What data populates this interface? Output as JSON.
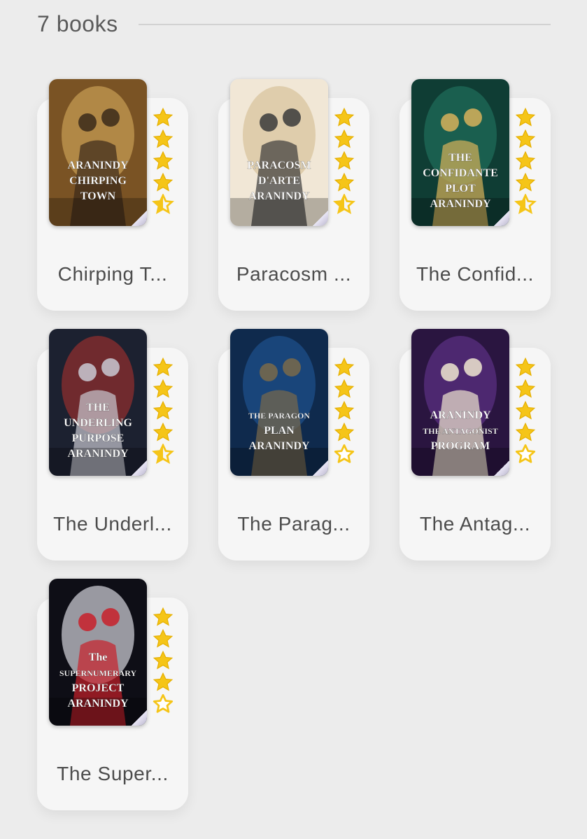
{
  "header": {
    "count_label": "7 books"
  },
  "colors": {
    "star": "#f5c518",
    "star_outline": "#e6b000",
    "card": "#f6f6f6",
    "background": "#ececec"
  },
  "books": [
    {
      "title": "Chirping Town",
      "display_title": "Chirping T...",
      "rating": 4.5,
      "cover_text": [
        "ARANINDY",
        "CHIRPING",
        "TOWN"
      ],
      "cover_colors": [
        "#7a5324",
        "#c49a52",
        "#3b2a1a"
      ]
    },
    {
      "title": "Paracosm D'Arte",
      "display_title": "Paracosm ...",
      "rating": 4.5,
      "cover_text": [
        "PARACOSM",
        "D'ARTE",
        "ARANINDY"
      ],
      "cover_colors": [
        "#f1e7d6",
        "#d8c49e",
        "#3a3a3a"
      ]
    },
    {
      "title": "The Confidante Plot",
      "display_title": "The Confid...",
      "rating": 4.5,
      "cover_text": [
        "THE",
        "CONFIDANTE",
        "PLOT",
        "ARANINDY"
      ],
      "cover_colors": [
        "#0f3d34",
        "#1f6b58",
        "#d8b25a"
      ]
    },
    {
      "title": "The Underling Purpose",
      "display_title": "The Underl...",
      "rating": 4.5,
      "cover_text": [
        "THE",
        "UNDERLING",
        "PURPOSE",
        "ARANINDY"
      ],
      "cover_colors": [
        "#1c2130",
        "#8c2e2e",
        "#c9c9d2"
      ]
    },
    {
      "title": "The Paragon Plan",
      "display_title": "The Parag...",
      "rating": 4,
      "cover_text": [
        "THE PARAGON",
        "PLAN",
        "ARANINDY"
      ],
      "cover_colors": [
        "#0f2a4d",
        "#1d4f8a",
        "#7a6a4a"
      ]
    },
    {
      "title": "The Antagonist Program",
      "display_title": "The Antag...",
      "rating": 4,
      "cover_text": [
        "ARANINDY",
        "THE ANTAGONIST",
        "PROGRAM"
      ],
      "cover_colors": [
        "#2a1540",
        "#5a2f80",
        "#f0e6d0"
      ]
    },
    {
      "title": "The Supernumerary Project",
      "display_title": "The Super...",
      "rating": 4,
      "cover_text": [
        "The",
        "SUPERNUMERARY",
        "PROJECT",
        "ARANINDY"
      ],
      "cover_colors": [
        "#0e0e16",
        "#c8c8d0",
        "#c8202a"
      ]
    }
  ]
}
